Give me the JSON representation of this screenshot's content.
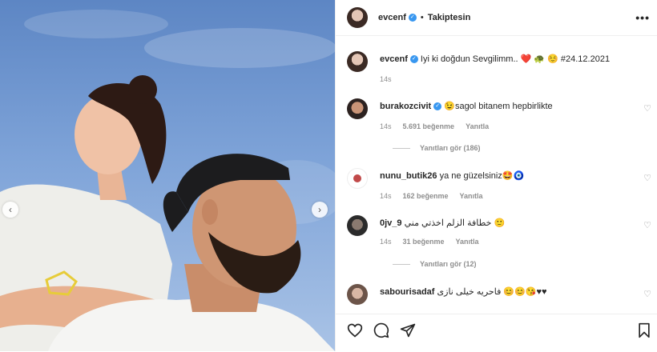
{
  "post": {
    "author": "evcenf",
    "follow_label": "Takiptesin",
    "dot": "•",
    "more": "•••",
    "caption": "Iyi ki doğdun Sevgilimm.. ❤️ 🐢 ☺️ #24.12.2021",
    "time": "14s"
  },
  "comments": [
    {
      "user": "burakozcivit",
      "verified": true,
      "text": "😉sagol bitanem hepbirlikte",
      "time": "14s",
      "likes": "5.691 beğenme",
      "reply": "Yanıtla",
      "replies": "Yanıtları gör (186)"
    },
    {
      "user": "nunu_butik26",
      "verified": false,
      "text": "ya ne güzelsiniz🤩🧿",
      "time": "14s",
      "likes": "162 beğenme",
      "reply": "Yanıtla",
      "replies": ""
    },
    {
      "user": "0jv_9",
      "verified": false,
      "text": "خطافة الزلم اخذتي مني 🙂",
      "time": "14s",
      "likes": "31 beğenme",
      "reply": "Yanıtla",
      "replies": "Yanıtları gör (12)"
    },
    {
      "user": "sabourisadaf",
      "verified": false,
      "text": "فاحريه خيلى نازى 😊😊😘♥♥",
      "time": "",
      "likes": "",
      "reply": "",
      "replies": ""
    }
  ],
  "icons": {
    "heart": "♡",
    "verified": "✓",
    "prev": "‹",
    "next": "›"
  },
  "colors": {
    "verified": "#3897f0",
    "sky": "#6f97d0"
  }
}
